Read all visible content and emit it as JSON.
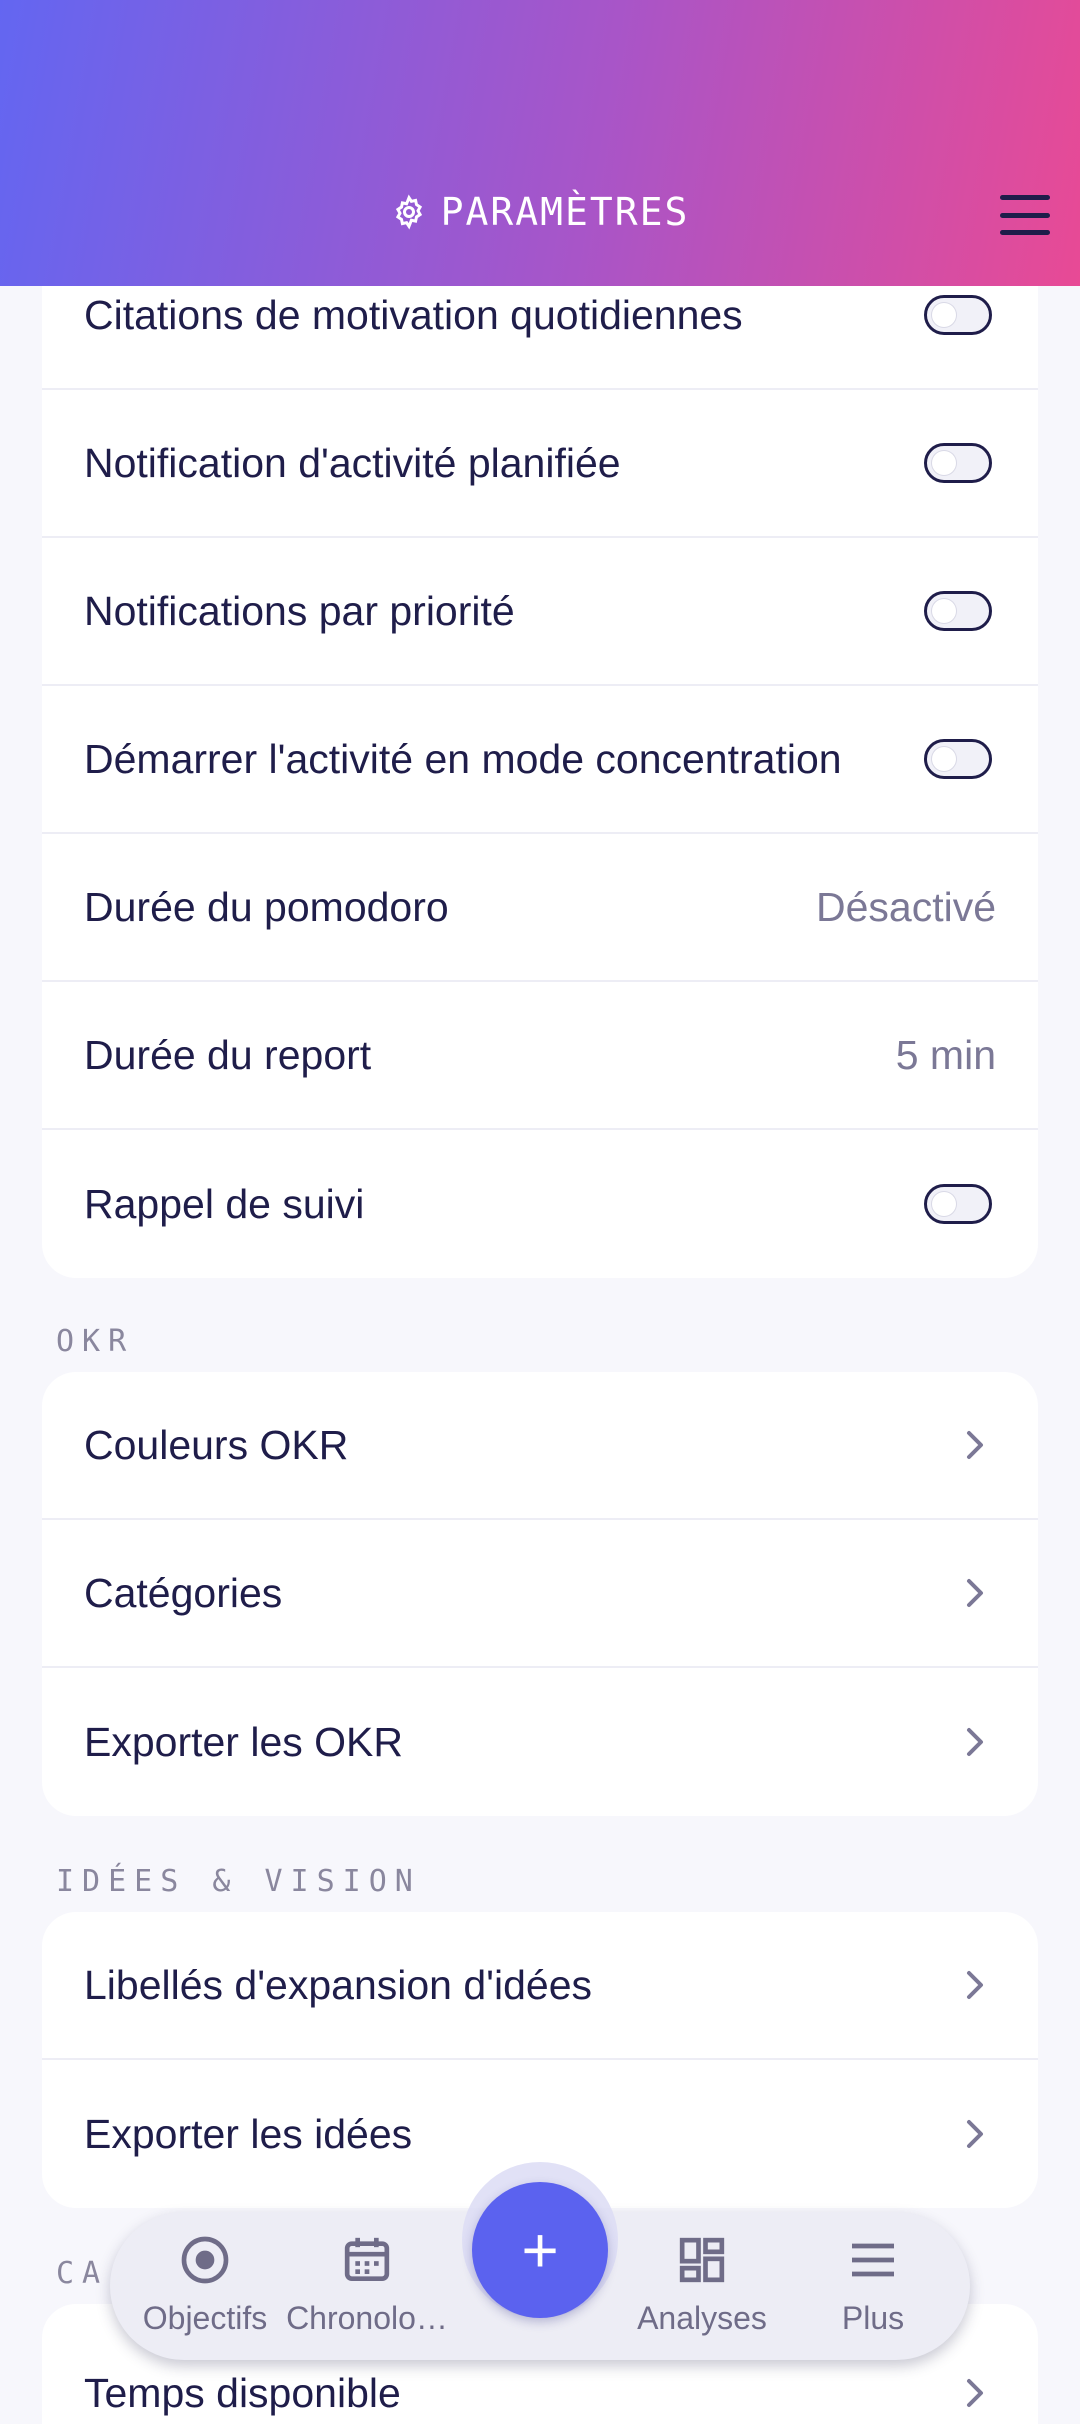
{
  "header": {
    "title": "PARAMÈTRES",
    "icon": "gear-icon",
    "menu_icon": "hamburger-menu-icon"
  },
  "notifications": [
    {
      "label": "Citations de motivation quotidiennes",
      "type": "toggle",
      "on": false
    },
    {
      "label": "Notification d'activité planifiée",
      "type": "toggle",
      "on": false
    },
    {
      "label": "Notifications par priorité",
      "type": "toggle",
      "on": false
    },
    {
      "label": "Démarrer l'activité en mode concentration",
      "type": "toggle",
      "on": false
    },
    {
      "label": "Durée du pomodoro",
      "type": "value",
      "value": "Désactivé"
    },
    {
      "label": "Durée du report",
      "type": "value",
      "value": "5 min"
    },
    {
      "label": "Rappel de suivi",
      "type": "toggle",
      "on": false
    }
  ],
  "okr": {
    "section_title": "OKR",
    "items": [
      {
        "label": "Couleurs OKR"
      },
      {
        "label": "Catégories"
      },
      {
        "label": "Exporter les OKR"
      }
    ]
  },
  "ideas": {
    "section_title": "IDÉES & VISION",
    "items": [
      {
        "label": "Libellés d'expansion d'idées"
      },
      {
        "label": "Exporter les idées"
      }
    ]
  },
  "calendar": {
    "section_title_partial": "CA",
    "items": [
      {
        "label": "Temps disponible"
      }
    ]
  },
  "bottom_nav": {
    "items": [
      {
        "label": "Objectifs",
        "icon": "target-icon"
      },
      {
        "label": "Chronolo…",
        "icon": "calendar-icon"
      },
      {
        "label": "Analyses",
        "icon": "dashboard-icon"
      },
      {
        "label": "Plus",
        "icon": "menu-lines-icon"
      }
    ],
    "fab_label": "+"
  },
  "colors": {
    "accent": "#5b62ef",
    "gradient_start": "#6366f1",
    "gradient_end": "#e84a95",
    "text": "#1f1d4a"
  }
}
